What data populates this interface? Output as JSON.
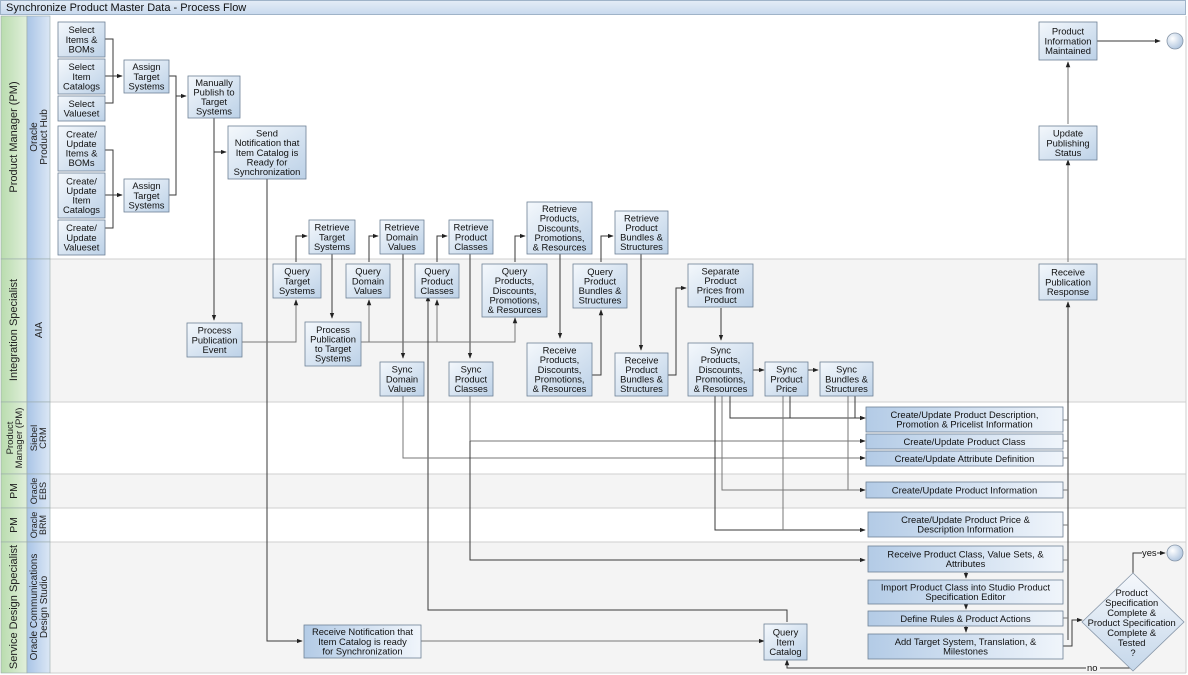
{
  "title": "Synchronize Product Master Data - Process Flow",
  "lanes": [
    {
      "role": "Product Manager (PM)",
      "system": [
        "Oracle",
        "Product Hub"
      ]
    },
    {
      "role": "Integration Specialist",
      "system": [
        "AIA"
      ]
    },
    {
      "role": [
        "Product",
        "Manager (PM)"
      ],
      "system": [
        "Siebel",
        "CRM"
      ]
    },
    {
      "role": "PM",
      "system": [
        "Oracle",
        "EBS"
      ]
    },
    {
      "role": "PM",
      "system": [
        "Oracle",
        "BRM"
      ]
    },
    {
      "role": "Service Design Specialist",
      "system": [
        "Oracle Communications",
        "Design Studio"
      ]
    }
  ],
  "nodes": {
    "select_items_boms": [
      "Select",
      "Items &",
      "BOMs"
    ],
    "select_item_catalogs": [
      "Select",
      "Item",
      "Catalogs"
    ],
    "select_valueset": [
      "Select",
      "Valueset"
    ],
    "create_items_boms": [
      "Create/",
      "Update",
      "Items &",
      "BOMs"
    ],
    "create_item_catalogs": [
      "Create/",
      "Update",
      "Item",
      "Catalogs"
    ],
    "create_valueset": [
      "Create/",
      "Update",
      "Valueset"
    ],
    "assign_target_1": [
      "Assign",
      "Target",
      "Systems"
    ],
    "assign_target_2": [
      "Assign",
      "Target",
      "Systems"
    ],
    "manually_publish": [
      "Manually",
      "Publish to",
      "Target",
      "Systems"
    ],
    "send_notification": [
      "Send",
      "Notification that",
      "Item Catalog is",
      "Ready for",
      "Synchronization"
    ],
    "product_info_maintained": [
      "Product",
      "Information",
      "Maintained"
    ],
    "update_publishing_status": [
      "Update",
      "Publishing",
      "Status"
    ],
    "retrieve_target_systems": [
      "Retrieve",
      "Target",
      "Systems"
    ],
    "retrieve_domain_values": [
      "Retrieve",
      "Domain",
      "Values"
    ],
    "retrieve_product_classes": [
      "Retrieve",
      "Product",
      "Classes"
    ],
    "retrieve_products": [
      "Retrieve",
      "Products,",
      "Discounts,",
      "Promotions,",
      "& Resources"
    ],
    "retrieve_bundles": [
      "Retrieve",
      "Product",
      "Bundles &",
      "Structures"
    ],
    "process_publication_event": [
      "Process",
      "Publication",
      "Event"
    ],
    "query_target_systems": [
      "Query",
      "Target",
      "Systems"
    ],
    "process_publication_target": [
      "Process",
      "Publication",
      "to Target",
      "Systems"
    ],
    "query_domain_values": [
      "Query",
      "Domain",
      "Values"
    ],
    "sync_domain_values": [
      "Sync",
      "Domain",
      "Values"
    ],
    "query_product_classes": [
      "Query",
      "Product",
      "Classes"
    ],
    "sync_product_classes": [
      "Sync",
      "Product",
      "Classes"
    ],
    "query_products": [
      "Query",
      "Products,",
      "Discounts,",
      "Promotions,",
      "& Resources"
    ],
    "receive_products": [
      "Receive",
      "Products,",
      "Discounts,",
      "Promotions,",
      "& Resources"
    ],
    "query_bundles": [
      "Query",
      "Product",
      "Bundles &",
      "Structures"
    ],
    "receive_bundles": [
      "Receive",
      "Product",
      "Bundles &",
      "Structures"
    ],
    "separate_prices": [
      "Separate",
      "Product",
      "Prices from",
      "Product"
    ],
    "sync_products": [
      "Sync",
      "Products,",
      "Discounts,",
      "Promotions,",
      "& Resources"
    ],
    "sync_product_price": [
      "Sync",
      "Product",
      "Price"
    ],
    "sync_bundles": [
      "Sync",
      "Bundles &",
      "Structures"
    ],
    "receive_publication_response": [
      "Receive",
      "Publication",
      "Response"
    ],
    "crm_desc_promo": [
      "Create/Update Product Description,",
      "Promotion & Pricelist Information"
    ],
    "crm_product_class": [
      "Create/Update Product Class"
    ],
    "crm_attribute_def": [
      "Create/Update Attribute Definition"
    ],
    "ebs_product_info": [
      "Create/Update Product Information"
    ],
    "brm_price_desc": [
      "Create/Update Product Price &",
      "Description Information"
    ],
    "receive_notification": [
      "Receive Notification that",
      "Item Catalog is ready",
      "for Synchronization"
    ],
    "query_item_catalog": [
      "Query",
      "Item",
      "Catalog"
    ],
    "receive_product_class": [
      "Receive Product Class, Value Sets, &",
      "Attributes"
    ],
    "import_product_class": [
      "Import Product Class into Studio Product",
      "Specification Editor"
    ],
    "define_rules": [
      "Define Rules & Product Actions"
    ],
    "add_target_system": [
      "Add Target System, Translation, &",
      "Milestones"
    ]
  },
  "decision": {
    "text": [
      "Product",
      "Specification",
      "Complete &",
      "Product Specification",
      "Complete &",
      "Tested",
      "?"
    ],
    "yes_label": "yes",
    "no_label": "no"
  },
  "colors": {
    "node_fill_top": "#eef3f9",
    "node_fill_bottom": "#bfd3e8",
    "role_green": "#cfe6c6",
    "system_blue": "#c3d6ee",
    "edge": "#3a3a3a"
  }
}
